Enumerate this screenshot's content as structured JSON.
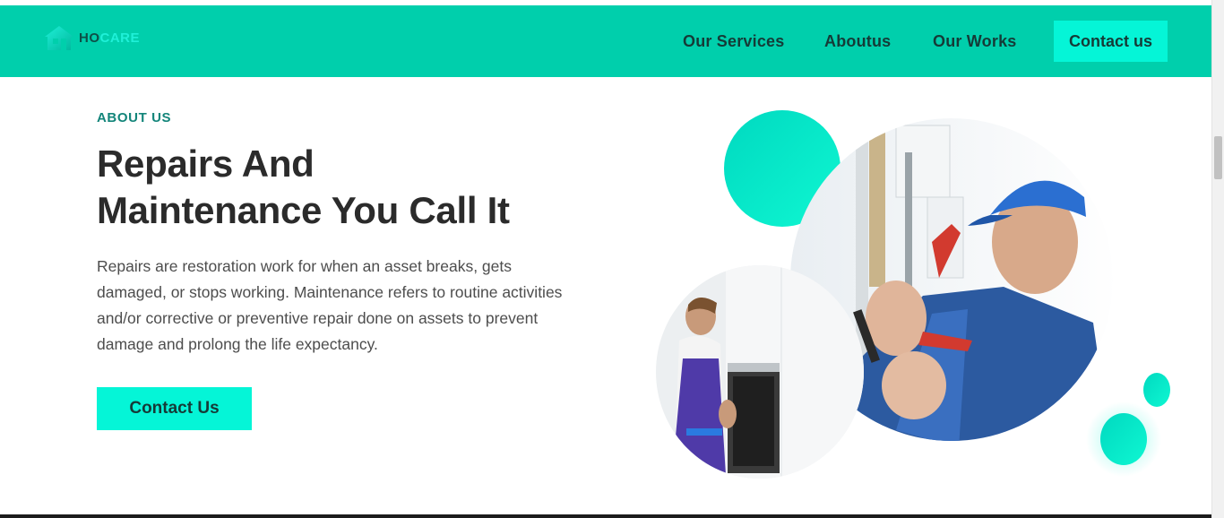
{
  "brand": {
    "logo_icon": "house-icon",
    "name_part1": "HO",
    "name_part2": "CARE",
    "color_primary": "#00cfac",
    "color_accent": "#05f5d7",
    "color_dark": "#153b37"
  },
  "nav": {
    "links": [
      "Our Services",
      "Aboutus",
      "Our Works"
    ],
    "contact_label": "Contact us"
  },
  "hero": {
    "eyebrow": "ABOUT US",
    "title_line1": "Repairs And",
    "title_line2": "Maintenance You Call It",
    "body": "Repairs are restoration work for when an asset breaks, gets damaged, or stops working. Maintenance refers to routine activities and/or corrective or preventive repair done on assets to prevent damage and prolong the life expectancy.",
    "cta_label": "Contact Us",
    "images": [
      "technician-photo",
      "oven-worker-photo"
    ]
  }
}
